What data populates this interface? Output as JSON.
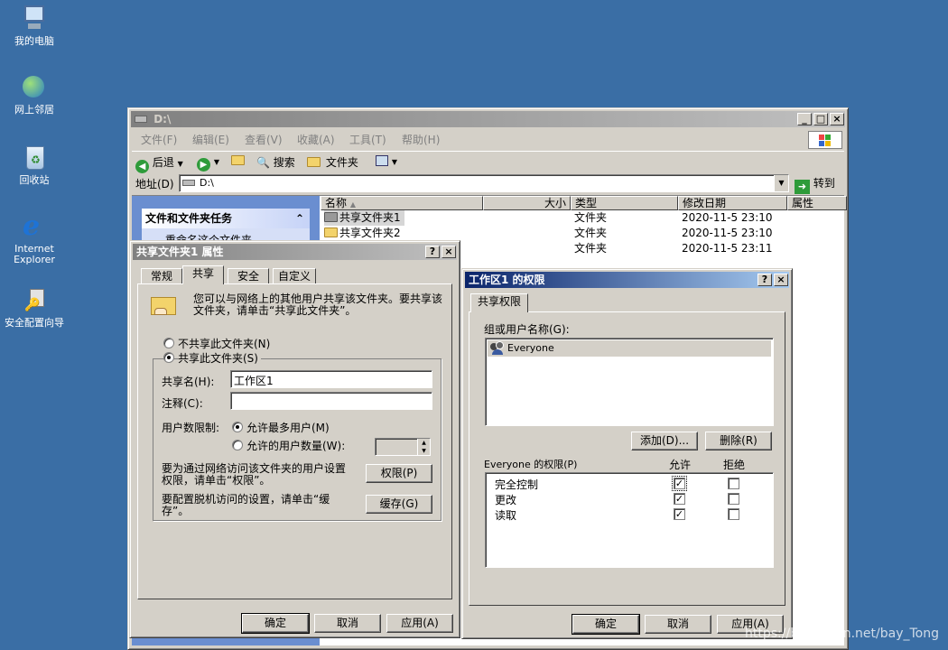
{
  "desktop": {
    "icons": [
      {
        "label": "我的电脑",
        "icon": "my-computer-icon"
      },
      {
        "label": "网上邻居",
        "icon": "network-places-icon"
      },
      {
        "label": "回收站",
        "icon": "recycle-bin-icon"
      },
      {
        "label": "Internet Explorer",
        "icon": "internet-explorer-icon"
      },
      {
        "label": "安全配置向导",
        "icon": "security-wizard-icon"
      }
    ],
    "watermark": "https://blog.csdn.net/bay_Tong"
  },
  "explorer": {
    "title": "D:\\",
    "menu": [
      "文件(F)",
      "编辑(E)",
      "查看(V)",
      "收藏(A)",
      "工具(T)",
      "帮助(H)"
    ],
    "toolbar": {
      "back": "后退",
      "search": "搜索",
      "folders": "文件夹"
    },
    "address": {
      "label": "地址(D)",
      "value": "D:\\",
      "go": "转到"
    },
    "task_panel": {
      "title": "文件和文件夹任务",
      "item": "重命名这个文件夹"
    },
    "columns": [
      "名称",
      "大小",
      "类型",
      "修改日期",
      "属性"
    ],
    "files": [
      {
        "name": "共享文件夹1",
        "type": "文件夹",
        "modified": "2020-11-5 23:10"
      },
      {
        "name": "共享文件夹2",
        "type": "文件夹",
        "modified": "2020-11-5 23:10"
      },
      {
        "name": "",
        "type": "文件夹",
        "modified": "2020-11-5 23:11"
      }
    ]
  },
  "properties": {
    "title": "共享文件夹1 属性",
    "tabs": [
      "常规",
      "共享",
      "安全",
      "自定义"
    ],
    "selected_tab": "共享",
    "intro": "您可以与网络上的其他用户共享该文件夹。要共享该文件夹，请单击“共享此文件夹”。",
    "no_share": "不共享此文件夹(N)",
    "share": "共享此文件夹(S)",
    "share_name_label": "共享名(H):",
    "share_name_value": "工作区1",
    "comment_label": "注释(C):",
    "comment_value": "",
    "user_limit_label": "用户数限制:",
    "max_users": "允许最多用户(M)",
    "allowed_users": "允许的用户数量(W):",
    "perm_text": "要为通过网络访问该文件夹的用户设置权限，请单击“权限”。",
    "perm_button": "权限(P)",
    "cache_text": "要配置脱机访问的设置，请单击“缓存”。",
    "cache_button": "缓存(G)",
    "ok": "确定",
    "cancel": "取消",
    "apply": "应用(A)"
  },
  "permissions": {
    "title": "工作区1 的权限",
    "tab": "共享权限",
    "group_label": "组或用户名称(G):",
    "users": [
      "Everyone"
    ],
    "add_button": "添加(D)...",
    "remove_button": "删除(R)",
    "perm_label": "Everyone 的权限(P)",
    "allow_header": "允许",
    "deny_header": "拒绝",
    "rows": [
      {
        "name": "完全控制",
        "allow": true,
        "deny": false
      },
      {
        "name": "更改",
        "allow": true,
        "deny": false
      },
      {
        "name": "读取",
        "allow": true,
        "deny": false
      }
    ],
    "ok": "确定",
    "cancel": "取消",
    "apply": "应用(A)"
  }
}
